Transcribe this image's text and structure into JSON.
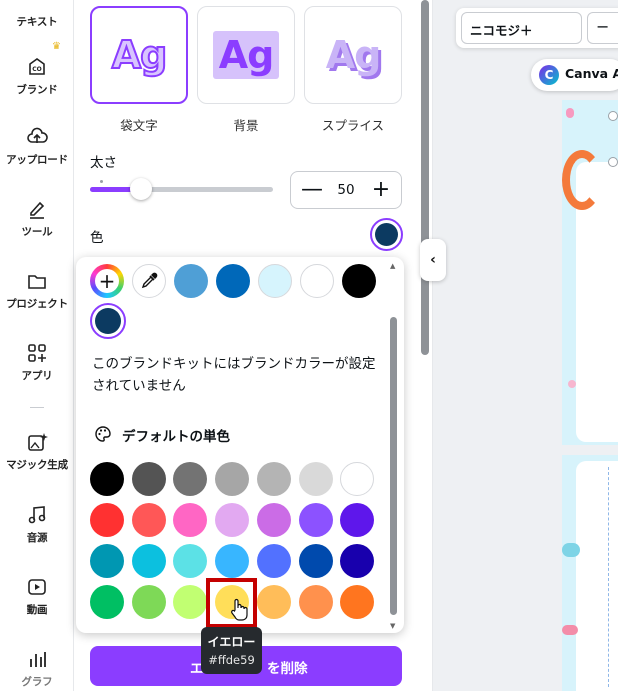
{
  "rail": {
    "items": [
      {
        "label": "テキスト",
        "icon": "text-icon"
      },
      {
        "label": "ブランド",
        "icon": "brand-icon"
      },
      {
        "label": "アップロード",
        "icon": "upload-cloud-icon"
      },
      {
        "label": "ツール",
        "icon": "pen-tool-icon"
      },
      {
        "label": "プロジェクト",
        "icon": "folder-icon"
      },
      {
        "label": "アプリ",
        "icon": "apps-grid-icon"
      },
      {
        "label": "マジック生成",
        "icon": "magic-image-icon"
      },
      {
        "label": "音源",
        "icon": "music-note-icon"
      },
      {
        "label": "動画",
        "icon": "video-play-icon"
      },
      {
        "label": "グラフ",
        "icon": "bar-chart-icon"
      }
    ]
  },
  "effects": {
    "items": [
      {
        "label": "袋文字",
        "sample": "Ag",
        "selected": true
      },
      {
        "label": "背景",
        "sample": "Ag",
        "selected": false
      },
      {
        "label": "スプライス",
        "sample": "Ag",
        "selected": false
      }
    ]
  },
  "thickness": {
    "label": "太さ",
    "value": "50",
    "fraction": 0.28,
    "minus": "—",
    "plus": "+"
  },
  "color": {
    "label": "色",
    "current": "#0c3a61"
  },
  "popup": {
    "document_colors": [
      "#4f9fd6",
      "#0068b9",
      "#d6f4fd",
      "#ffffff",
      "#000000",
      "#0c3a61"
    ],
    "brand_message": "このブランドキットにはブランドカラーが設定されていません",
    "default_title": "デフォルトの単色",
    "default_colors": [
      "#000000",
      "#545454",
      "#737373",
      "#a6a6a6",
      "#b4b4b4",
      "#d9d9d9",
      "#ffffff",
      "#ff3131",
      "#ff5757",
      "#ff66c4",
      "#e2a9f1",
      "#cb6ce6",
      "#8c52ff",
      "#5e17eb",
      "#0097b2",
      "#0cc0df",
      "#5ce1e6",
      "#38b6ff",
      "#5271ff",
      "#004aad",
      "#1800ad",
      "#00bf63",
      "#7ed957",
      "#c1ff72",
      "#ffde59",
      "#ffbd59",
      "#ff914d",
      "#ff751f"
    ]
  },
  "tooltip": {
    "name": "イエロー",
    "hex": "#ffde59"
  },
  "delete_button": {
    "left": "エ",
    "right": "を削除"
  },
  "canvas": {
    "font_name": "ニコモジ＋",
    "minus": "−",
    "assistant": "Canva A"
  },
  "accent": "#8b3dff"
}
